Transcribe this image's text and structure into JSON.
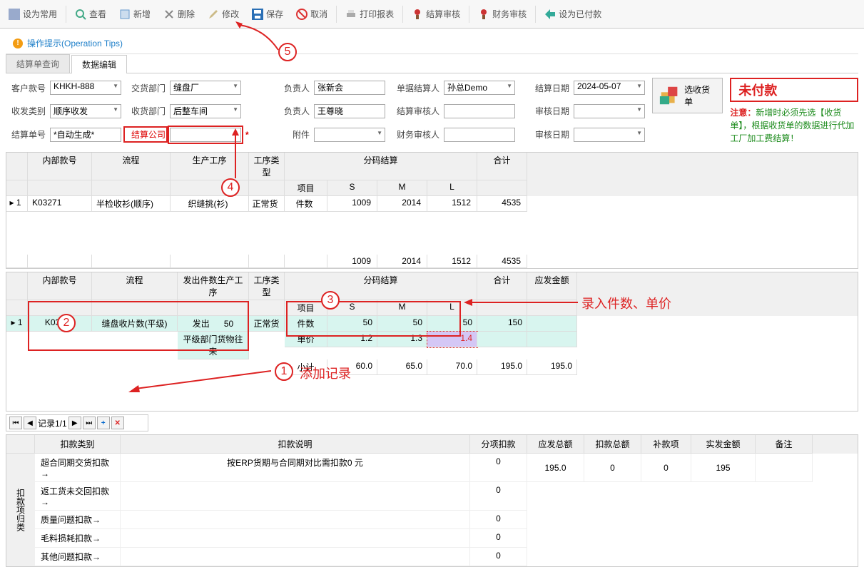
{
  "toolbar": {
    "set_common": "设为常用",
    "view": "查看",
    "add": "新增",
    "delete": "删除",
    "edit": "修改",
    "save": "保存",
    "cancel": "取消",
    "print": "打印报表",
    "settle_audit": "结算审核",
    "finance_audit": "财务审核",
    "set_paid": "设为已付款"
  },
  "tips": {
    "label": "操作提示(Operation Tips)"
  },
  "tabs": {
    "query": "结算单查询",
    "edit": "数据编辑"
  },
  "form": {
    "customer_style_lbl": "客户款号",
    "customer_style": "KHKH-888",
    "deliver_dept_lbl": "交货部门",
    "deliver_dept": "缝盘厂",
    "owner_lbl": "负责人",
    "owner": "张新会",
    "bill_settler_lbl": "单据结算人",
    "bill_settler": "孙总Demo",
    "settle_date_lbl": "结算日期",
    "settle_date": "2024-05-07",
    "rx_type_lbl": "收发类别",
    "rx_type": "顺序收发",
    "recv_dept_lbl": "收货部门",
    "recv_dept": "后整车间",
    "owner2_lbl": "负责人",
    "owner2": "王尊晓",
    "settle_auditor_lbl": "结算审核人",
    "settle_auditor": "",
    "audit_date_lbl": "审核日期",
    "audit_date": "",
    "settle_no_lbl": "结算单号",
    "settle_no": "*自动生成*",
    "settle_co_lbl": "结算公司",
    "settle_co": "",
    "attach_lbl": "附件",
    "attach": "",
    "fin_auditor_lbl": "财务审核人",
    "fin_auditor": "",
    "audit_date2_lbl": "审核日期",
    "audit_date2": ""
  },
  "side": {
    "select_receipt": "选收货单",
    "status": "未付款",
    "warn_prefix": "注意：",
    "warn_text": "新增时必须先选【收货单】，根据收货单的数据进行代加工厂加工费结算！"
  },
  "grid1": {
    "cols": {
      "style": "内部款号",
      "flow": "流程",
      "proc": "生产工序",
      "proc_type": "工序类型",
      "size_group": "分码结算",
      "item": "项目",
      "s": "S",
      "m": "M",
      "l": "L",
      "total": "合计"
    },
    "row": {
      "idx": "1",
      "style": "K03271",
      "flow": "半检收衫(顺序)",
      "proc": "织缝挑(衫)",
      "proc_type": "正常货",
      "item": "件数",
      "s": "1009",
      "m": "2014",
      "l": "1512",
      "total": "4535"
    },
    "totals": {
      "s": "1009",
      "m": "2014",
      "l": "1512",
      "total": "4535"
    }
  },
  "grid2": {
    "cols": {
      "style": "内部款号",
      "flow": "流程",
      "sent_proc": "发出件数生产工序",
      "proc_type": "工序类型",
      "size_group": "分码结算",
      "item": "项目",
      "s": "S",
      "m": "M",
      "l": "L",
      "total": "合计",
      "amount": "应发金额"
    },
    "r1": {
      "idx": "1",
      "style": "K03271",
      "flow": "缝盘收片数(平级)",
      "sent": "发出",
      "sent_qty": "50",
      "proc": "平级部门货物往来",
      "proc_type": "正常货"
    },
    "items": {
      "pcs": {
        "label": "件数",
        "s": "50",
        "m": "50",
        "l": "50",
        "total": "150",
        "amount": ""
      },
      "price": {
        "label": "单价",
        "s": "1.2",
        "m": "1.3",
        "l": "1.4",
        "total": "",
        "amount": ""
      },
      "subtotal": {
        "label": "小计",
        "s": "60.0",
        "m": "65.0",
        "l": "70.0",
        "total": "195.0",
        "amount": "195.0"
      }
    }
  },
  "annot": {
    "add_record": "添加记录",
    "enter_price": "录入件数、单价"
  },
  "recnav": {
    "text": "记录1/1"
  },
  "ded": {
    "vlabel": "扣款项归类",
    "cols": {
      "cat": "扣款类别",
      "desc": "扣款说明",
      "sub": "分项扣款",
      "total_due": "应发总额",
      "ded_total": "扣款总额",
      "supp": "补款项",
      "actual": "实发金额",
      "remark": "备注"
    },
    "rows": [
      {
        "cat": "超合同期交货扣款→",
        "desc": "按ERP货期与合同期对比需扣款0 元",
        "sub": "0"
      },
      {
        "cat": "返工货未交回扣款→",
        "desc": "",
        "sub": "0"
      },
      {
        "cat": "质量问题扣款→",
        "desc": "",
        "sub": "0"
      },
      {
        "cat": "毛料损耗扣款→",
        "desc": "",
        "sub": "0"
      },
      {
        "cat": "其他问题扣款→",
        "desc": "",
        "sub": "0"
      }
    ],
    "summary": {
      "total_due": "195.0",
      "ded_total": "0",
      "supp": "0",
      "actual": "195"
    }
  }
}
